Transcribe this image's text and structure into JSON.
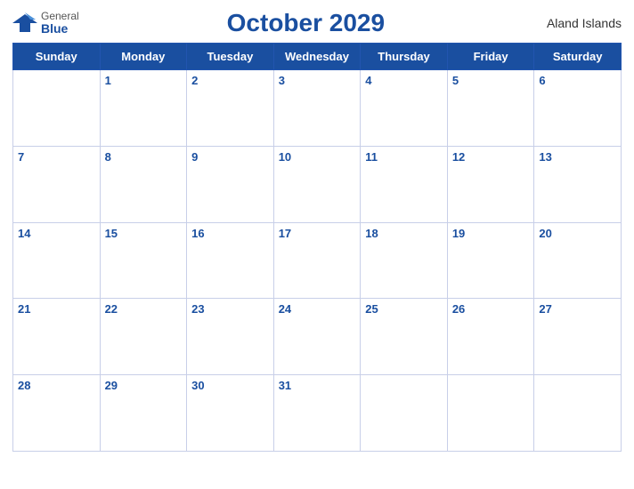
{
  "header": {
    "logo_general": "General",
    "logo_blue": "Blue",
    "title": "October 2029",
    "region": "Aland Islands"
  },
  "weekdays": [
    "Sunday",
    "Monday",
    "Tuesday",
    "Wednesday",
    "Thursday",
    "Friday",
    "Saturday"
  ],
  "weeks": [
    [
      {
        "day": "",
        "empty": true
      },
      {
        "day": "1"
      },
      {
        "day": "2"
      },
      {
        "day": "3"
      },
      {
        "day": "4"
      },
      {
        "day": "5"
      },
      {
        "day": "6"
      }
    ],
    [
      {
        "day": "7"
      },
      {
        "day": "8"
      },
      {
        "day": "9"
      },
      {
        "day": "10"
      },
      {
        "day": "11"
      },
      {
        "day": "12"
      },
      {
        "day": "13"
      }
    ],
    [
      {
        "day": "14"
      },
      {
        "day": "15"
      },
      {
        "day": "16"
      },
      {
        "day": "17"
      },
      {
        "day": "18"
      },
      {
        "day": "19"
      },
      {
        "day": "20"
      }
    ],
    [
      {
        "day": "21"
      },
      {
        "day": "22"
      },
      {
        "day": "23"
      },
      {
        "day": "24"
      },
      {
        "day": "25"
      },
      {
        "day": "26"
      },
      {
        "day": "27"
      }
    ],
    [
      {
        "day": "28"
      },
      {
        "day": "29"
      },
      {
        "day": "30"
      },
      {
        "day": "31"
      },
      {
        "day": ""
      },
      {
        "day": ""
      },
      {
        "day": ""
      }
    ]
  ],
  "colors": {
    "header_bg": "#1a4fa0",
    "day_number": "#1a4fa0",
    "border": "#c8cfe8"
  }
}
